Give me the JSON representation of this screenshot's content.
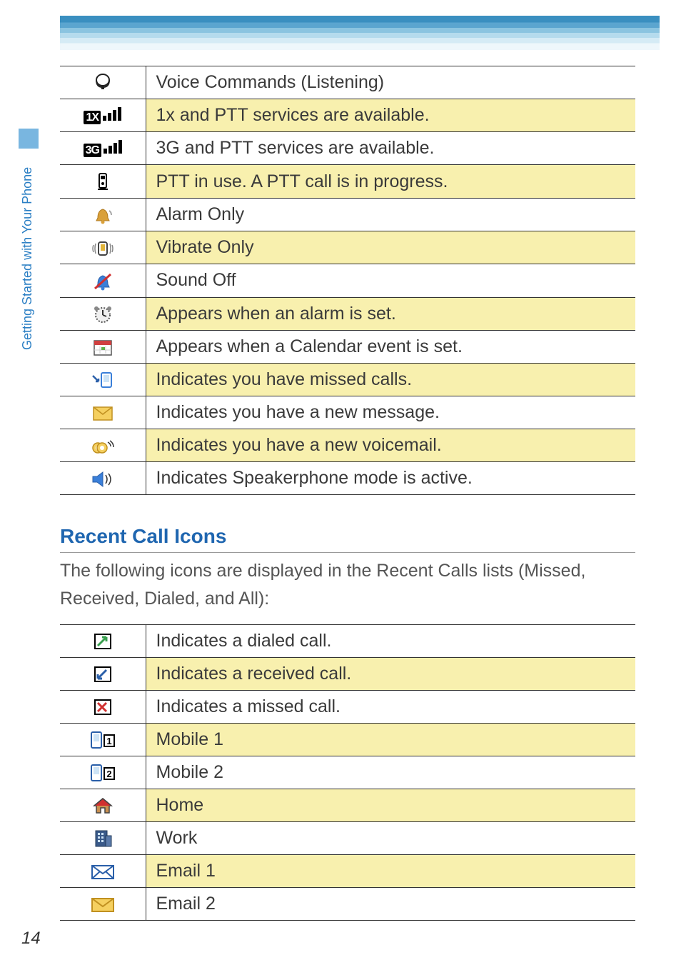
{
  "side_tab_label": "Getting Started with Your Phone",
  "page_number": "14",
  "status_icons": [
    {
      "icon": "voice-commands-icon",
      "desc": "Voice Commands (Listening)"
    },
    {
      "icon": "signal-1x-icon",
      "desc": "1x and PTT services are available."
    },
    {
      "icon": "signal-3g-icon",
      "desc": "3G and PTT services are available."
    },
    {
      "icon": "ptt-in-use-icon",
      "desc": "PTT in use. A PTT call is in progress."
    },
    {
      "icon": "alarm-only-icon",
      "desc": "Alarm Only"
    },
    {
      "icon": "vibrate-only-icon",
      "desc": "Vibrate Only"
    },
    {
      "icon": "sound-off-icon",
      "desc": "Sound Off"
    },
    {
      "icon": "alarm-set-icon",
      "desc": "Appears when an alarm is set."
    },
    {
      "icon": "calendar-event-icon",
      "desc": "Appears when a Calendar event is set."
    },
    {
      "icon": "missed-calls-icon",
      "desc": "Indicates you have missed calls."
    },
    {
      "icon": "new-message-icon",
      "desc": "Indicates you have a new message."
    },
    {
      "icon": "new-voicemail-icon",
      "desc": "Indicates you have a new voicemail."
    },
    {
      "icon": "speakerphone-icon",
      "desc": "Indicates Speakerphone mode is active."
    }
  ],
  "recent_calls": {
    "title": "Recent Call Icons",
    "description": "The following icons are displayed in the Recent Calls lists (Missed, Received, Dialed, and All):",
    "rows": [
      {
        "icon": "dialed-call-icon",
        "desc": "Indicates a dialed call."
      },
      {
        "icon": "received-call-icon",
        "desc": "Indicates a received call."
      },
      {
        "icon": "missed-call-icon",
        "desc": "Indicates a missed call."
      },
      {
        "icon": "mobile-1-icon",
        "desc": "Mobile 1"
      },
      {
        "icon": "mobile-2-icon",
        "desc": "Mobile 2"
      },
      {
        "icon": "home-icon",
        "desc": "Home"
      },
      {
        "icon": "work-icon",
        "desc": "Work"
      },
      {
        "icon": "email-1-icon",
        "desc": "Email 1"
      },
      {
        "icon": "email-2-icon",
        "desc": "Email 2"
      }
    ]
  }
}
